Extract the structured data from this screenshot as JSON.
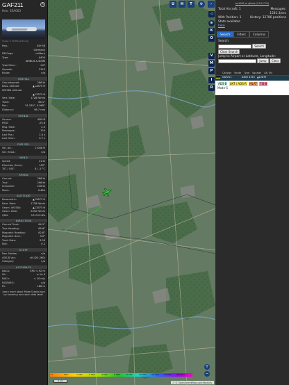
{
  "info": {
    "callsign": "GAF211",
    "hex_label": "Hex:",
    "hex": "3EA063",
    "photo_credit": "Image © Matthias Becker",
    "rows1": [
      {
        "k": "Reg.:",
        "v": "54+38"
      },
      {
        "k": "",
        "v": "Germany"
      },
      {
        "k": "DB flags:",
        "v": "military"
      },
      {
        "k": "Type:",
        "v": "A400"
      },
      {
        "k": "",
        "v": "AIRBUS A-400M"
      },
      {
        "k": "Type Desc.:",
        "v": "L4T"
      },
      {
        "k": "Squawk:",
        "v": "3153"
      },
      {
        "k": "Route:",
        "v": "n/a"
      }
    ],
    "sections": [
      {
        "title": "SPATIAL",
        "rows": [
          {
            "k": "Groundspeed:",
            "v": "286 kt"
          },
          {
            "k": "Baro. altitude:",
            "v": "▲12875 ft"
          },
          {
            "k": "WGS84 altitude:",
            "v": ""
          },
          {
            "k": "",
            "v": "▲13375 ft"
          },
          {
            "k": "Vert. Rate:",
            "v": "1728 ft/min"
          },
          {
            "k": "Track:",
            "v": "64.1°"
          },
          {
            "k": "Pos.:",
            "v": "51.535°, 5.965°"
          },
          {
            "k": "Distance:",
            "v": "98.7 nmi"
          }
        ]
      },
      {
        "title": "SIGNAL",
        "rows": [
          {
            "k": "Source:",
            "v": "ADS-B"
          },
          {
            "k": "RSSI:",
            "v": "-25.8"
          },
          {
            "k": "Msg. Rate:",
            "v": "2.5"
          },
          {
            "k": "Messages:",
            "v": "129"
          },
          {
            "k": "Last Pos.:",
            "v": "2.4 s"
          },
          {
            "k": "Last Seen:",
            "v": "0.7 s"
          }
        ]
      },
      {
        "title": "FMS SEL",
        "rows": [
          {
            "k": "Sel. Alt.:",
            "v": "17008 ft"
          },
          {
            "k": "Sel. Head.:",
            "v": "n/a"
          }
        ]
      },
      {
        "title": "WIND",
        "rows": [
          {
            "k": "Speed:",
            "v": "11 kt"
          },
          {
            "k": "Direction (from):",
            "v": "102°"
          },
          {
            "k": "TAT / OAT:",
            "v": "8 / -5 °C"
          }
        ]
      },
      {
        "title": "SPEED",
        "rows": [
          {
            "k": "Ground:",
            "v": "286 kt"
          },
          {
            "k": "True:",
            "v": "296 kt"
          },
          {
            "k": "Indicated:",
            "v": "246 kt"
          },
          {
            "k": "Mach:",
            "v": "0.464"
          }
        ]
      },
      {
        "title": "ALTITUDE",
        "rows": [
          {
            "k": "Barometric:",
            "v": "▲12875 ft"
          },
          {
            "k": "Baro. Rate:",
            "v": "1728 ft/min"
          },
          {
            "k": "Geom. WGS84:",
            "v": "▲13375 ft"
          },
          {
            "k": "Geom. Rate:",
            "v": "2432 ft/min"
          },
          {
            "k": "QNH:",
            "v": "1013.0 hPa"
          }
        ]
      },
      {
        "title": "DIRECTION",
        "rows": [
          {
            "k": "Ground Track:",
            "v": "64.1°"
          },
          {
            "k": "True Heading:",
            "v": "65.6°"
          },
          {
            "k": "Magnetic Heading:",
            "v": "62.8°"
          },
          {
            "k": "Magnetic Decl.:",
            "v": "3.0°"
          },
          {
            "k": "Track Rate:",
            "v": "0.03"
          },
          {
            "k": "Roll:",
            "v": "0.2"
          }
        ]
      },
      {
        "title": "STUFF",
        "rows": [
          {
            "k": "Nav. Modes:",
            "v": "n/a"
          },
          {
            "k": "ADS-B Ver.:",
            "v": "v0 (DO-260)"
          },
          {
            "k": "Category:",
            "v": "n/a"
          }
        ]
      },
      {
        "title": "ACCURACY",
        "rows": [
          {
            "k": "NACp:",
            "v": "EPU < 92 m"
          },
          {
            "k": "SIL:",
            "v": "≤ 1e-5"
          },
          {
            "k": "NACv:",
            "v": "< 10 m/s"
          },
          {
            "k": "NICBARO:",
            "v": "n/a"
          },
          {
            "k": "Rc:",
            "v": "186 m"
          }
        ]
      }
    ],
    "note": "Learn more about Mode S data type by hovering over each data label."
  },
  "map": {
    "top_buttons": [
      "U",
      "H",
      "T"
    ],
    "side_buttons": [
      "◁",
      "⊕",
      "K",
      "O",
      "V",
      "M",
      "P",
      "I",
      "R"
    ],
    "legend_labels": [
      "0",
      "500",
      "1 000",
      "2 000",
      "4 000",
      "6 000",
      "8 000",
      "10 000",
      "20 000",
      "30 000",
      "40 000+"
    ],
    "scale": "2 km",
    "attribution": "© OpenStreetMap contributors.",
    "zoom_in": "+",
    "zoom_out": "−",
    "colors": {
      "route": "#3fbf3f",
      "aircraft": "#36c23c"
    }
  },
  "right": {
    "ticker": "tar1090 on github (3.14.1711)",
    "total_label": "Total Aircraft:",
    "total": "1",
    "messages_label": "Messages:",
    "messages": "1581.3/sec",
    "withpos_label": "With Position:",
    "withpos": "1",
    "history_label": "History:",
    "history": "32786 positions",
    "stats_label": "Stats available",
    "stats_link": "here",
    "tabs": [
      "Search",
      "Filters",
      "Columns"
    ],
    "search_label": "Search:",
    "search_btn": "Search",
    "clear_search": "Clear Search",
    "jump_label": "Jump to Airport or Latitude, Longitude:",
    "jump_btn": "Jump",
    "clear_btn": "Clear",
    "columns": [
      "Callsign",
      "Route",
      "Type",
      "Squawk",
      "Alt. (ft)"
    ],
    "row": {
      "flag": "de",
      "callsign": "GAF211",
      "type": "A400",
      "squawk": "3153",
      "alt": "▲12875"
    },
    "tags": [
      "ADS-B",
      "UAT / ADS-R",
      "MLAT",
      "TIS-B"
    ],
    "mode": "Mode-S"
  }
}
